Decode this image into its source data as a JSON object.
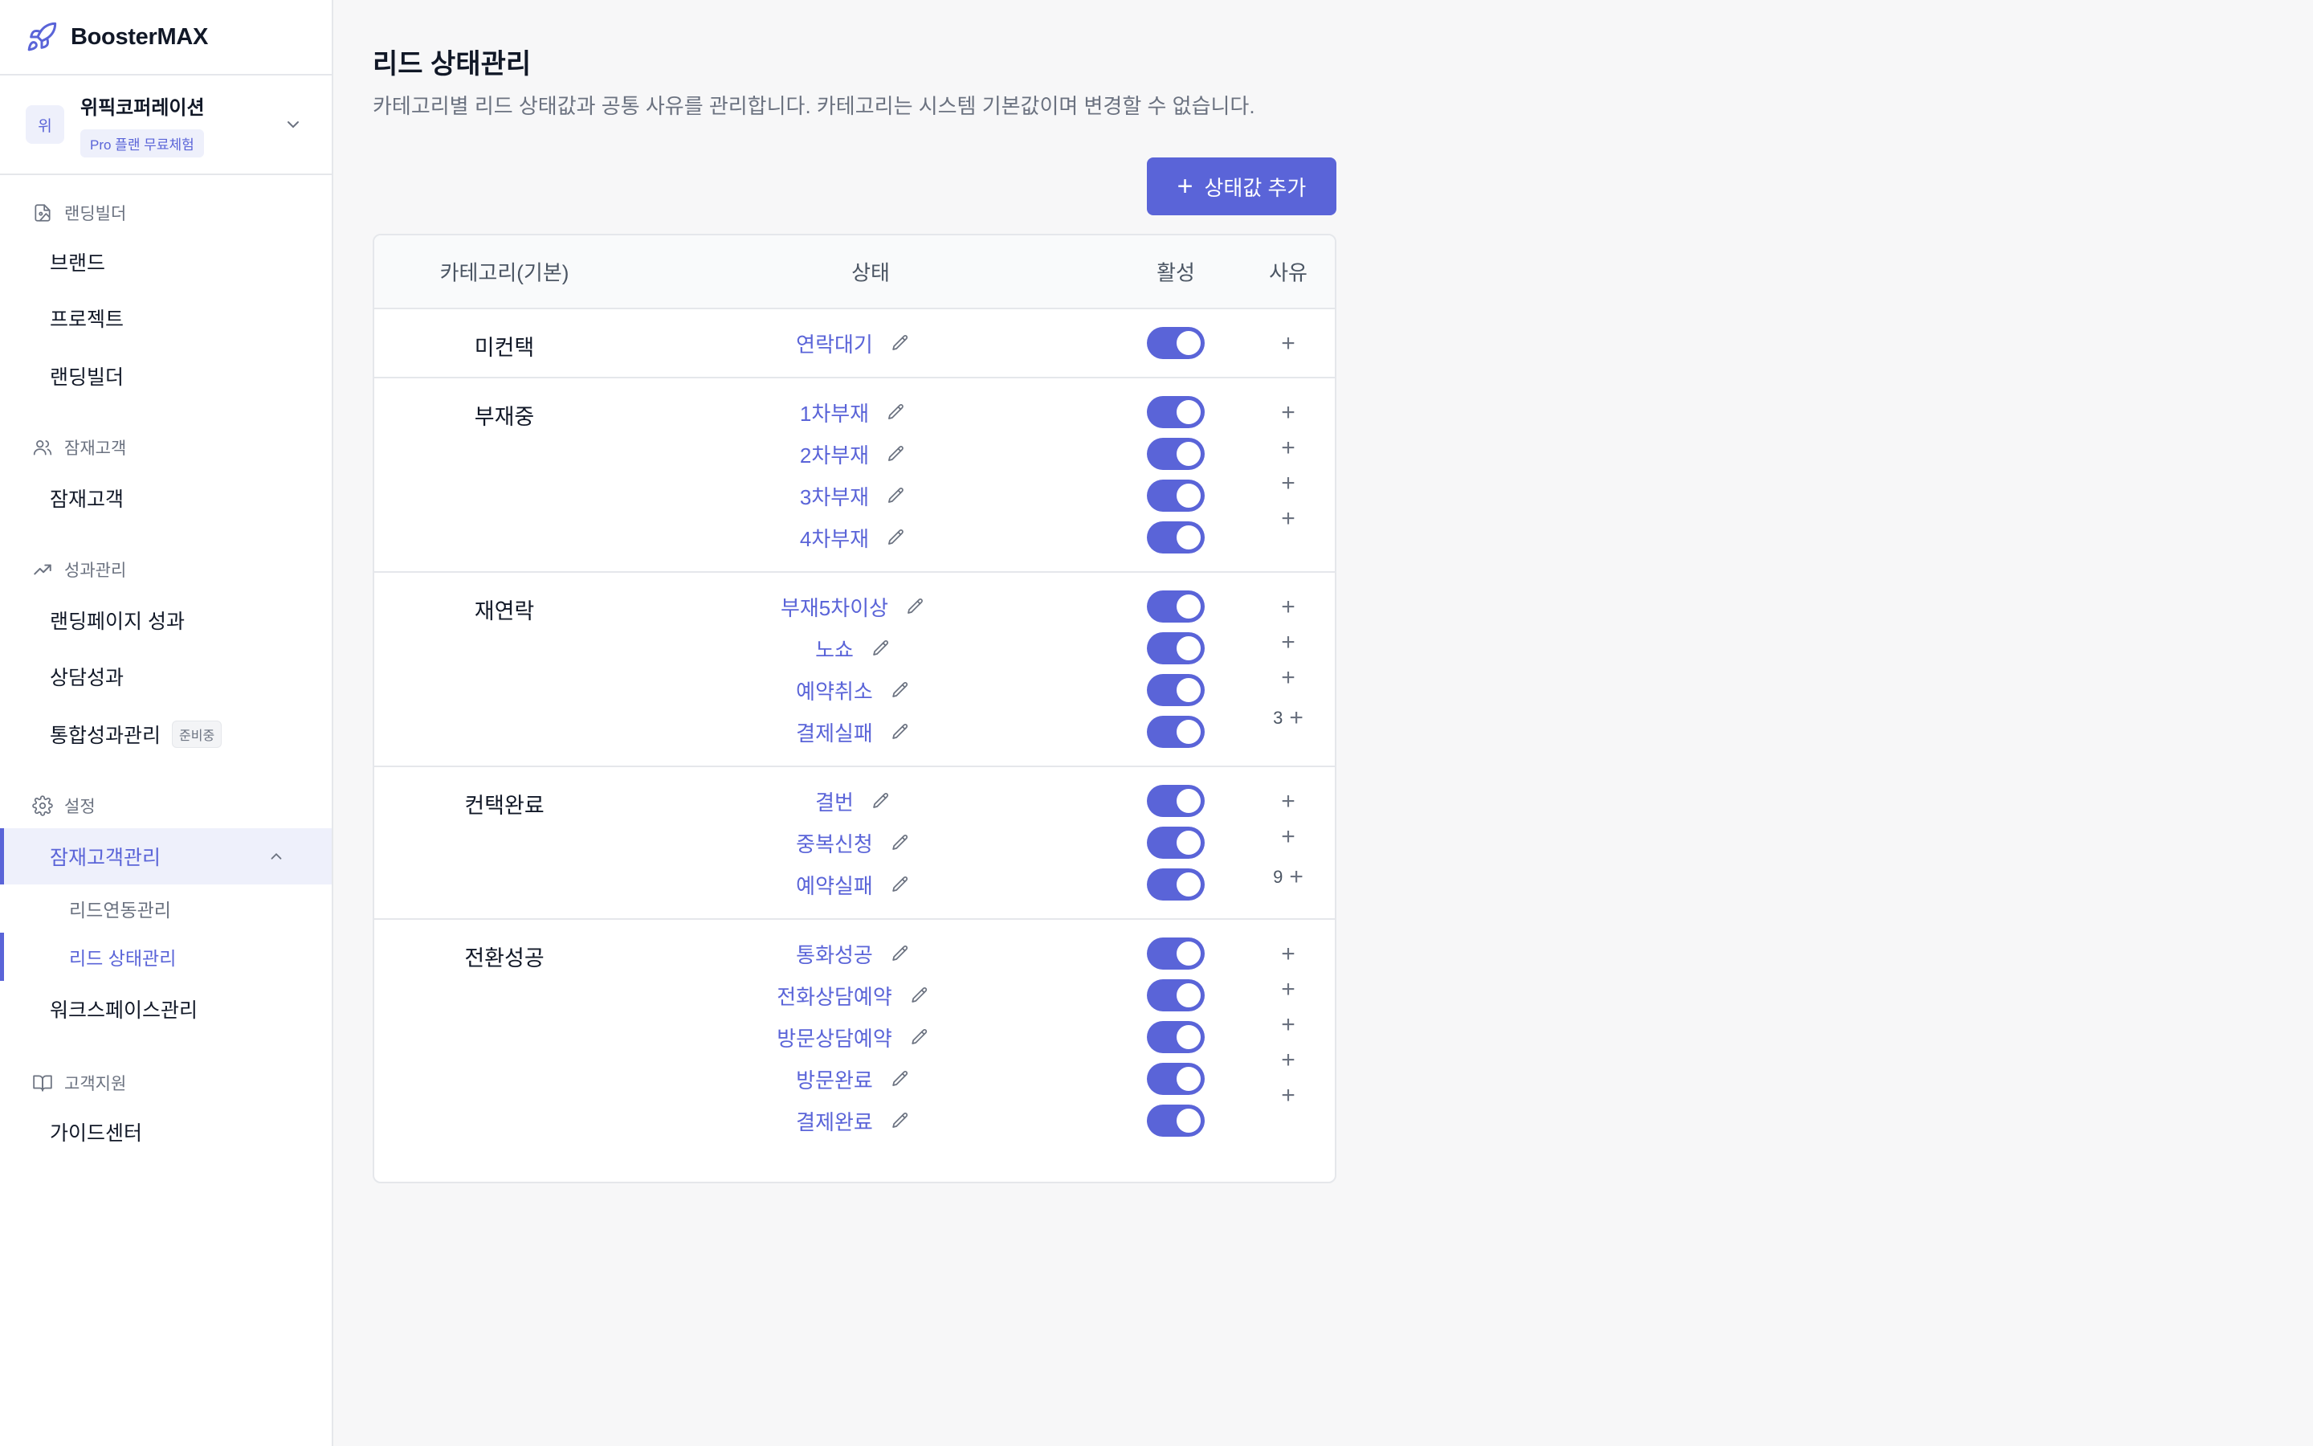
{
  "app": {
    "name": "BoosterMAX"
  },
  "workspace": {
    "avatar": "위",
    "name": "위픽코퍼레이션",
    "plan_badge": "Pro 플랜 무료체험"
  },
  "sidebar": {
    "sections": [
      {
        "label": "랜딩빌더",
        "icon": "landing-file-icon"
      },
      {
        "label": "잠재고객",
        "icon": "users-icon"
      },
      {
        "label": "성과관리",
        "icon": "trending-up-icon"
      },
      {
        "label": "설정",
        "icon": "gear-icon"
      },
      {
        "label": "고객지원",
        "icon": "book-icon"
      }
    ],
    "items": {
      "brand": "브랜드",
      "project": "프로젝트",
      "landing_builder": "랜딩빌더",
      "prospects": "잠재고객",
      "landing_performance": "랜딩페이지 성과",
      "consult_performance": "상담성과",
      "integrated_performance": "통합성과관리",
      "integrated_badge": "준비중",
      "prospect_management": "잠재고객관리",
      "lead_sync": "리드연동관리",
      "lead_status": "리드 상태관리",
      "workspace_management": "워크스페이스관리",
      "guide_center": "가이드센터"
    }
  },
  "page": {
    "title": "리드 상태관리",
    "description": "카테고리별 리드 상태값과 공통 사유를 관리합니다. 카테고리는 시스템 기본값이며 변경할 수 없습니다.",
    "add_button": "상태값 추가"
  },
  "table": {
    "headers": {
      "category": "카테고리(기본)",
      "status": "상태",
      "active": "활성",
      "reason": "사유"
    },
    "groups": [
      {
        "category": "미컨택",
        "statuses": [
          "연락대기"
        ],
        "reason_count": ""
      },
      {
        "category": "부재중",
        "statuses": [
          "1차부재",
          "2차부재",
          "3차부재",
          "4차부재"
        ],
        "reason_count": ""
      },
      {
        "category": "재연락",
        "statuses": [
          "부재5차이상",
          "노쇼",
          "예약취소",
          "결제실패"
        ],
        "reason_count": "3"
      },
      {
        "category": "컨택완료",
        "statuses": [
          "결번",
          "중복신청",
          "예약실패"
        ],
        "reason_count": "9"
      },
      {
        "category": "전환성공",
        "statuses": [
          "통화성공",
          "전화상담예약",
          "방문상담예약",
          "방문완료",
          "결제완료"
        ],
        "reason_count": ""
      }
    ],
    "toggle_states": "all-on"
  },
  "colors": {
    "accent": "#5a64d8",
    "accent_light": "#eef0fb"
  }
}
